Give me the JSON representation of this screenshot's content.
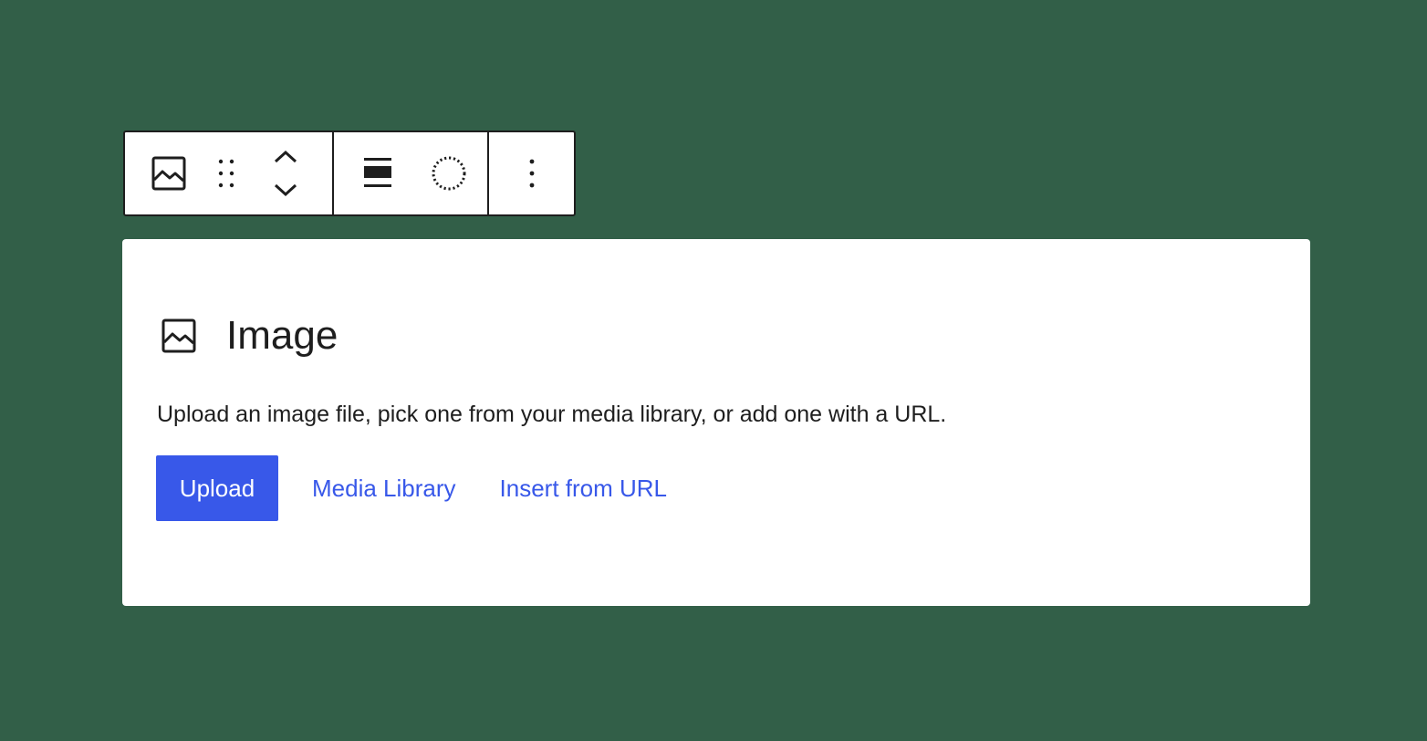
{
  "toolbar": {
    "groups": [
      {
        "items": [
          {
            "icon": "image-icon",
            "label": "Image"
          },
          {
            "icon": "drag-handle-icon",
            "label": "Drag"
          },
          {
            "icon": "move-up-down-icon",
            "label": "Move up / Move down"
          }
        ]
      },
      {
        "items": [
          {
            "icon": "align-icon",
            "label": "Align"
          },
          {
            "icon": "duotone-icon",
            "label": "Apply duotone filter"
          }
        ]
      },
      {
        "items": [
          {
            "icon": "more-options-icon",
            "label": "Options"
          }
        ]
      }
    ]
  },
  "placeholder": {
    "icon": "image-icon",
    "title": "Image",
    "description": "Upload an image file, pick one from your media library, or add one with a URL.",
    "upload_label": "Upload",
    "media_library_label": "Media Library",
    "insert_url_label": "Insert from URL"
  },
  "colors": {
    "background": "#325f48",
    "accent": "#3858e9",
    "text": "#1e1e1e",
    "card": "#ffffff"
  }
}
